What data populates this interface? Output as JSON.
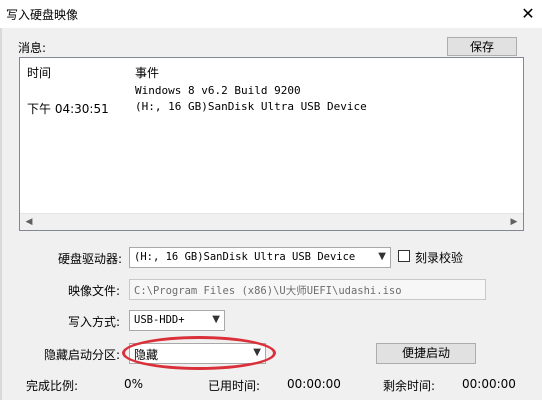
{
  "window": {
    "title": "写入硬盘映像",
    "close_glyph": "✕"
  },
  "messages": {
    "label": "消息:",
    "save_button": "保存",
    "columns": {
      "time": "时间",
      "event": "事件"
    },
    "rows": [
      {
        "time": "",
        "event": "Windows 8 v6.2 Build 9200"
      },
      {
        "time": "下午 04:30:51",
        "event": "(H:, 16 GB)SanDisk Ultra USB Device"
      }
    ]
  },
  "form": {
    "drive_label": "硬盘驱动器:",
    "drive_value": "(H:, 16 GB)SanDisk Ultra USB Device",
    "verify_label": "刻录校验",
    "image_label": "映像文件:",
    "image_value": "C:\\Program Files (x86)\\U大师UEFI\\udashi.iso",
    "method_label": "写入方式:",
    "method_value": "USB-HDD+",
    "hidden_label": "隐藏启动分区:",
    "hidden_value": "隐藏",
    "quick_boot_button": "便捷启动"
  },
  "status": {
    "progress_label": "完成比例:",
    "progress_value": "0%",
    "elapsed_label": "已用时间:",
    "elapsed_value": "00:00:00",
    "remaining_label": "剩余时间:",
    "remaining_value": "00:00:00"
  },
  "colors": {
    "highlight_oval": "#d9303a"
  }
}
